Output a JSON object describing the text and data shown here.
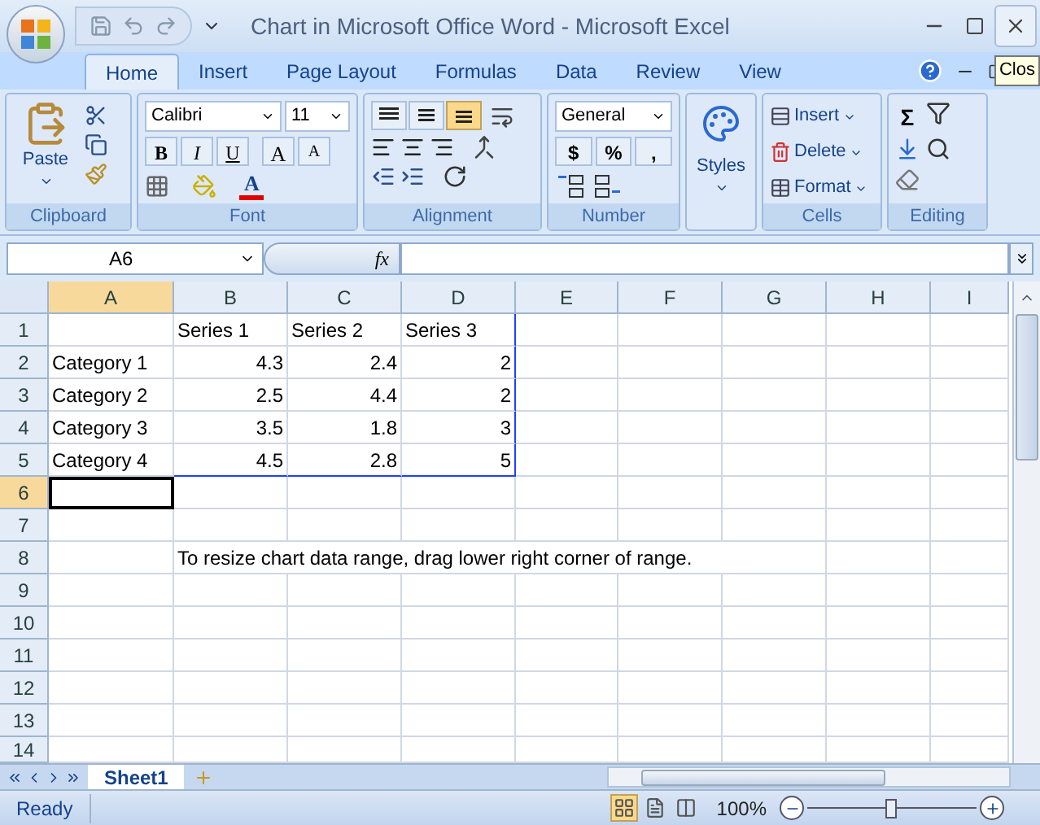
{
  "window": {
    "title": "Chart in Microsoft Office Word - Microsoft Excel",
    "tooltip": "Clos"
  },
  "tabs": [
    {
      "label": "Home",
      "selected": true
    },
    {
      "label": "Insert",
      "selected": false
    },
    {
      "label": "Page Layout",
      "selected": false
    },
    {
      "label": "Formulas",
      "selected": false
    },
    {
      "label": "Data",
      "selected": false
    },
    {
      "label": "Review",
      "selected": false
    },
    {
      "label": "View",
      "selected": false
    }
  ],
  "ribbon": {
    "clipboard": {
      "label": "Clipboard",
      "paste": "Paste"
    },
    "font": {
      "label": "Font",
      "font_name": "Calibri",
      "font_size": "11",
      "style_buttons": [
        "B",
        "I",
        "U"
      ],
      "grow": "A",
      "shrink": "A",
      "font_color": "A"
    },
    "alignment": {
      "label": "Alignment",
      "vertical_buttons": [
        {
          "kind": "top",
          "selected": false
        },
        {
          "kind": "middle",
          "selected": false
        },
        {
          "kind": "bottom",
          "selected": true
        }
      ]
    },
    "number": {
      "label": "Number",
      "format": "General",
      "buttons": [
        "$",
        "%",
        ","
      ]
    },
    "styles": {
      "label": "Styles"
    },
    "cells": {
      "label": "Cells",
      "buttons": [
        "Insert",
        "Delete",
        "Format"
      ]
    },
    "editing": {
      "label": "Editing",
      "sum": "Σ"
    }
  },
  "formula_bar": {
    "name_box": "A6",
    "function_label": "fx"
  },
  "grid": {
    "columns": [
      {
        "label": "A",
        "selected": true
      },
      {
        "label": "B",
        "selected": false
      },
      {
        "label": "C",
        "selected": false
      },
      {
        "label": "D",
        "selected": false
      },
      {
        "label": "E",
        "selected": false
      },
      {
        "label": "F",
        "selected": false
      },
      {
        "label": "G",
        "selected": false
      },
      {
        "label": "H",
        "selected": false
      },
      {
        "label": "I",
        "selected": false
      }
    ],
    "rows": [
      {
        "header": "1",
        "selected": false,
        "cells": [
          null,
          "Series 1",
          "Series 2",
          "Series 3"
        ]
      },
      {
        "header": "2",
        "selected": false,
        "cells": [
          "Category 1",
          "4.3",
          "2.4",
          "2"
        ]
      },
      {
        "header": "3",
        "selected": false,
        "cells": [
          "Category 2",
          "2.5",
          "4.4",
          "2"
        ]
      },
      {
        "header": "4",
        "selected": false,
        "cells": [
          "Category 3",
          "3.5",
          "1.8",
          "3"
        ]
      },
      {
        "header": "5",
        "selected": false,
        "cells": [
          "Category 4",
          "4.5",
          "2.8",
          "5"
        ]
      },
      {
        "header": "6",
        "selected": true,
        "cells": []
      },
      {
        "header": "7",
        "selected": false,
        "cells": []
      },
      {
        "header": "8",
        "selected": false,
        "cells": [
          null,
          "To resize chart data range, drag lower right corner of range."
        ]
      },
      {
        "header": "9",
        "selected": false,
        "cells": []
      },
      {
        "header": "10",
        "selected": false,
        "cells": []
      },
      {
        "header": "11",
        "selected": false,
        "cells": []
      },
      {
        "header": "12",
        "selected": false,
        "cells": []
      },
      {
        "header": "13",
        "selected": false,
        "cells": []
      },
      {
        "header": "14",
        "selected": false,
        "cells": []
      }
    ]
  },
  "sheet_tabs": [
    {
      "label": "Sheet1",
      "selected": true
    }
  ],
  "status_bar": {
    "status": "Ready",
    "views": [
      {
        "kind": "normal",
        "selected": true
      },
      {
        "kind": "page-layout",
        "selected": false
      },
      {
        "kind": "page-break",
        "selected": false
      }
    ],
    "zoom": "100%",
    "zoom_slider": {
      "level": 0.5
    }
  }
}
